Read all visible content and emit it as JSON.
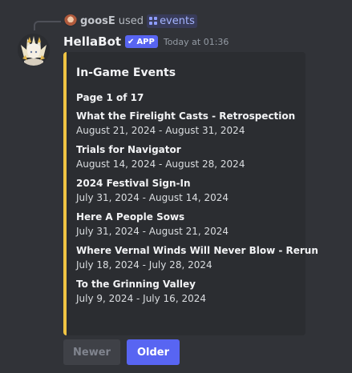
{
  "reply": {
    "user": "goosE",
    "used_text": "used",
    "command": "events"
  },
  "message": {
    "bot_name": "HellaBot",
    "badge": "APP",
    "timestamp": "Today at 01:36"
  },
  "embed": {
    "accent_color": "#f0c443",
    "title": "In-Game Events",
    "page": "Page 1 of 17",
    "events": [
      {
        "name": "What the Firelight Casts - Retrospection",
        "dates": "August 21, 2024 - August 31, 2024"
      },
      {
        "name": "Trials for Navigator",
        "dates": "August 14, 2024 - August 28, 2024"
      },
      {
        "name": "2024 Festival Sign-In",
        "dates": "July 31, 2024 - August 14, 2024"
      },
      {
        "name": "Here A People Sows",
        "dates": "July 31, 2024 - August 21, 2024"
      },
      {
        "name": "Where Vernal Winds Will Never Blow - Rerun",
        "dates": "July 18, 2024 - July 28, 2024"
      },
      {
        "name": "To the Grinning Valley",
        "dates": "July 9, 2024 - July 16, 2024"
      }
    ]
  },
  "buttons": {
    "newer": "Newer",
    "older": "Older"
  },
  "icons": {
    "command": "slash-command-grid-icon",
    "badge": "check-icon"
  }
}
